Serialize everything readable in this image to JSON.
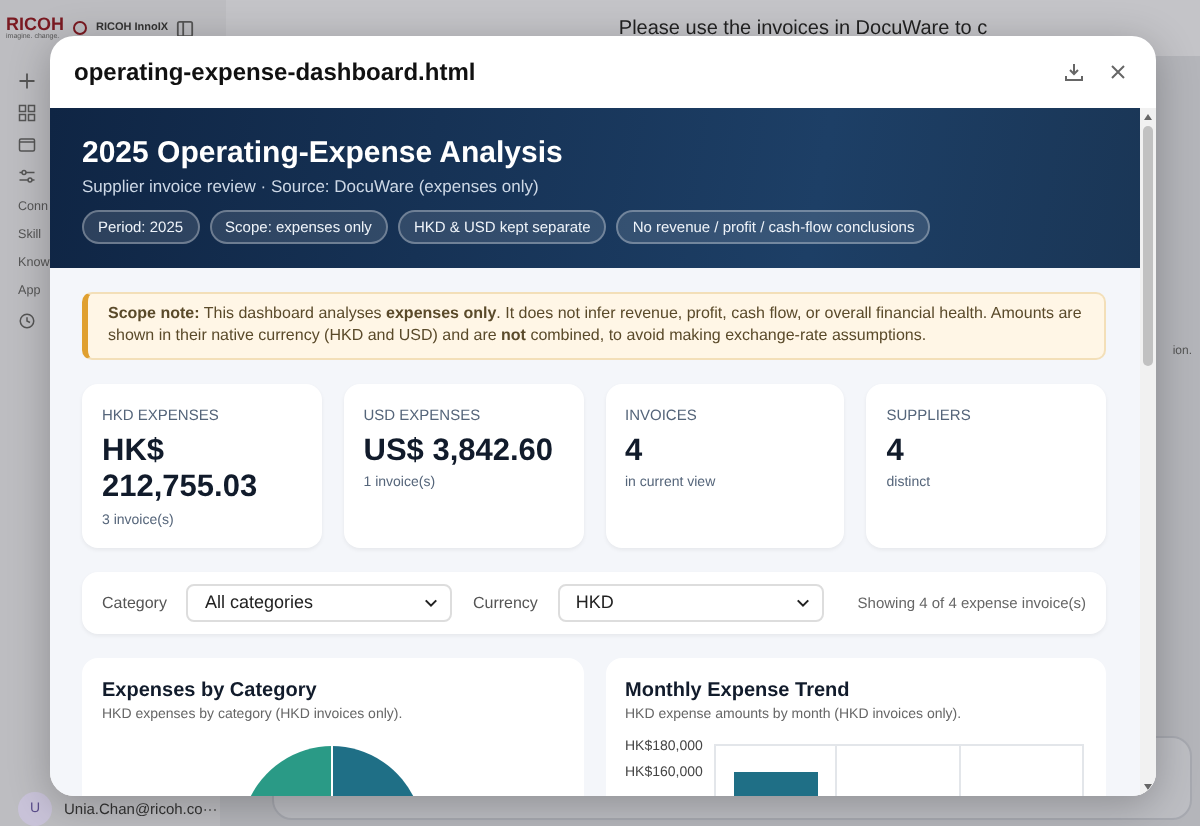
{
  "app": {
    "logo": "RICOH",
    "logo_tagline": "imagine. change.",
    "product": "RICOH InnoIX",
    "chat_title": "Please use the invoices in DocuWare to c",
    "sidebar_items": [
      "Conn",
      "Skill",
      "Know",
      "App"
    ],
    "side_text": "ion.",
    "user": {
      "initial": "U",
      "email": "Unia.Chan@ricoh.co···"
    }
  },
  "dialog": {
    "title": "operating-expense-dashboard.html",
    "banner": {
      "title": "2025 Operating-Expense Analysis",
      "subtitle": "Supplier invoice review · Source: DocuWare (expenses only)",
      "chips": [
        "Period: 2025",
        "Scope: expenses only",
        "HKD & USD kept separate",
        "No revenue / profit / cash-flow conclusions"
      ]
    },
    "note": "**Scope note:** This dashboard analyses **expenses only**. It does not infer revenue, profit, cash flow, or overall financial health. Amounts are shown in their native currency (HKD and USD) and are **not** combined, to avoid making exchange-rate assumptions.",
    "kpis": [
      {
        "label": "HKD EXPENSES",
        "value": "HK$ 212,755.03",
        "detail": "3 invoice(s)"
      },
      {
        "label": "USD EXPENSES",
        "value": "US$ 3,842.60",
        "detail": "1 invoice(s)"
      },
      {
        "label": "INVOICES",
        "value": "4",
        "detail": "in current view"
      },
      {
        "label": "SUPPLIERS",
        "value": "4",
        "detail": "distinct"
      }
    ],
    "filters": [
      {
        "label": "Category",
        "value": "All categories"
      },
      {
        "label": "Currency",
        "value": "HKD"
      }
    ],
    "showing": "Showing 4 of 4 expense invoice(s)",
    "category_chart": {
      "title": "Expenses by Category",
      "subtitle": "HKD expenses by category (HKD invoices only)."
    },
    "trend_chart": {
      "title": "Monthly Expense Trend",
      "subtitle": "HKD expense amounts by month (HKD invoices only).",
      "y_tick_labels": [
        "HK$180,000",
        "HK$160,000"
      ]
    }
  }
}
